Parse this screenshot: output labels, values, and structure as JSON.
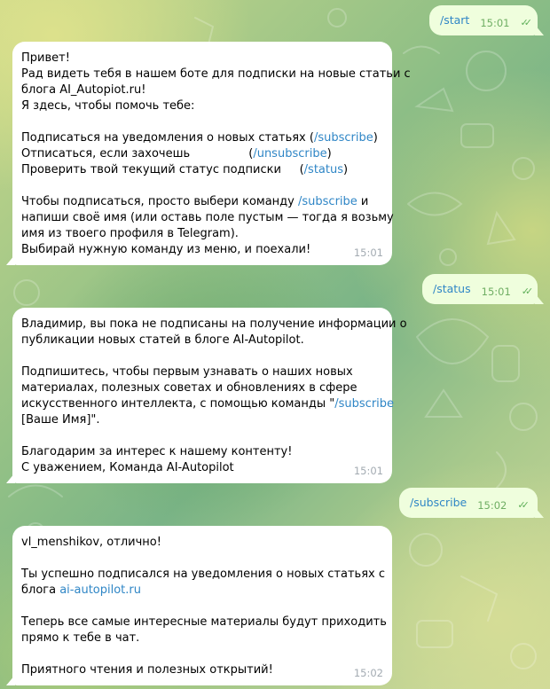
{
  "messages": [
    {
      "type": "outgoing",
      "text": "/start",
      "time": "15:01",
      "status_icon": "double-check-icon"
    },
    {
      "type": "incoming",
      "time": "15:01",
      "lines": [
        [
          "Привет!"
        ],
        [
          "Рад видеть тебя в нашем боте для подписки на новые статьи с"
        ],
        [
          "блога AI_Autopiot.ru!"
        ],
        [
          "Я здесь, чтобы помочь тебе:"
        ],
        [
          ""
        ],
        [
          "Подписаться на уведомления о новых статьях (",
          {
            "link": "/subscribe"
          },
          ")"
        ],
        [
          "Отписаться, если захочешь                (",
          {
            "link": "/unsubscribe"
          },
          ")"
        ],
        [
          "Проверить твой текущий статус подписки     (",
          {
            "link": "/status"
          },
          ")"
        ],
        [
          ""
        ],
        [
          "Чтобы подписаться, просто выбери команду ",
          {
            "link": "/subscribe"
          },
          " и"
        ],
        [
          "напиши своё имя (или оставь поле пустым — тогда я возьму"
        ],
        [
          "имя из твоего профиля в Telegram)."
        ],
        [
          "Выбирай нужную команду из меню, и поехали!"
        ]
      ]
    },
    {
      "type": "outgoing",
      "text": "/status",
      "time": "15:01",
      "status_icon": "double-check-icon"
    },
    {
      "type": "incoming",
      "time": "15:01",
      "lines": [
        [
          "Владимир, вы пока не подписаны на получение информации о"
        ],
        [
          "публикации новых статей в блоге AI-Autopilot."
        ],
        [
          ""
        ],
        [
          "Подпишитесь, чтобы первым узнавать о наших новых"
        ],
        [
          "материалах, полезных советах и обновлениях в сфере"
        ],
        [
          "искусственного интеллекта, с помощью команды \"",
          {
            "link": "/subscribe"
          }
        ],
        [
          "[Ваше Имя]\"."
        ],
        [
          ""
        ],
        [
          "Благодарим за интерес к нашему контенту!"
        ],
        [
          "С уважением, Команда AI-Autopilot"
        ]
      ]
    },
    {
      "type": "outgoing",
      "text": "/subscribe",
      "time": "15:02",
      "status_icon": "double-check-icon"
    },
    {
      "type": "incoming",
      "time": "15:02",
      "lines": [
        [
          "vl_menshikov, отлично!"
        ],
        [
          ""
        ],
        [
          "Ты успешно подписался на уведомления о новых статьях с"
        ],
        [
          "блога ",
          {
            "link": "ai-autopilot.ru"
          }
        ],
        [
          ""
        ],
        [
          "Теперь все самые интересные материалы будут приходить"
        ],
        [
          "прямо к тебе в чат."
        ],
        [
          ""
        ],
        [
          "Приятного чтения и полезных открытий!"
        ]
      ]
    }
  ]
}
